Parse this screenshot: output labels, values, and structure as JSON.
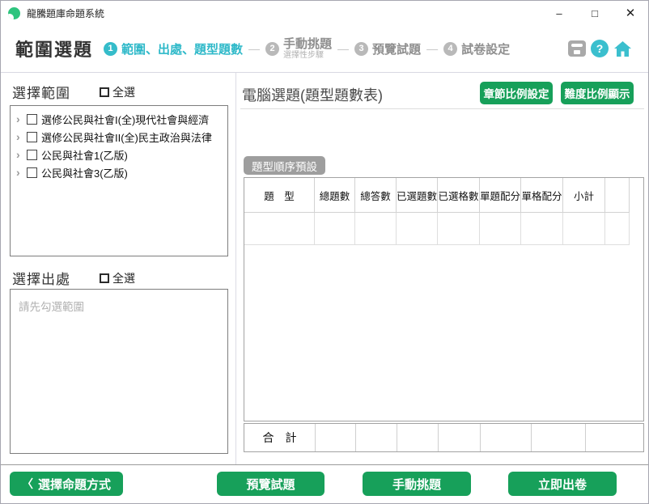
{
  "window": {
    "title": "龍騰題庫命題系統",
    "controls": {
      "minimize": "–",
      "maximize": "□",
      "close": "✕"
    }
  },
  "header": {
    "page_title": "範圍選題",
    "step_separator": "—",
    "steps": [
      {
        "num": "1",
        "label": "範圍、出處、題型題數",
        "sub": "",
        "active": true
      },
      {
        "num": "2",
        "label": "手動挑題",
        "sub": "選擇性步驟",
        "active": false
      },
      {
        "num": "3",
        "label": "預覽試題",
        "sub": "",
        "active": false
      },
      {
        "num": "4",
        "label": "試卷設定",
        "sub": "",
        "active": false
      }
    ],
    "help_glyph": "?"
  },
  "left": {
    "range": {
      "title": "選擇範圍",
      "select_all_label": "全選",
      "items": [
        "選修公民與社會I(全)現代社會與經濟",
        "選修公民與社會II(全)民主政治與法律",
        "公民與社會1(乙版)",
        "公民與社會3(乙版)"
      ]
    },
    "source": {
      "title": "選擇出處",
      "select_all_label": "全選",
      "placeholder": "請先勾選範圍"
    }
  },
  "right": {
    "title": "電腦選題(題型題數表)",
    "chapter_ratio_button": "章節比例設定",
    "difficulty_ratio_button": "難度比例顯示",
    "badge": "題型順序預設",
    "table": {
      "headers": [
        "題　型",
        "總題數",
        "總答數",
        "已選題數",
        "已選格數",
        "單題配分",
        "單格配分",
        "小計",
        ""
      ],
      "rows": [
        [
          "",
          "",
          "",
          "",
          "",
          "",
          "",
          "",
          ""
        ]
      ]
    },
    "total_row": {
      "label": "合　計",
      "cells": [
        "",
        "",
        "",
        "",
        "",
        "",
        ""
      ]
    }
  },
  "footer": {
    "back_chevron": "〈",
    "back_button": "選擇命題方式",
    "preview_button": "預覽試題",
    "manual_button": "手動挑題",
    "generate_button": "立即出卷"
  },
  "icons": {
    "tree_chevron": "›"
  },
  "colors": {
    "accent_green": "#17a05a",
    "accent_teal": "#35bcca",
    "badge_gray": "#9e9e9e"
  }
}
